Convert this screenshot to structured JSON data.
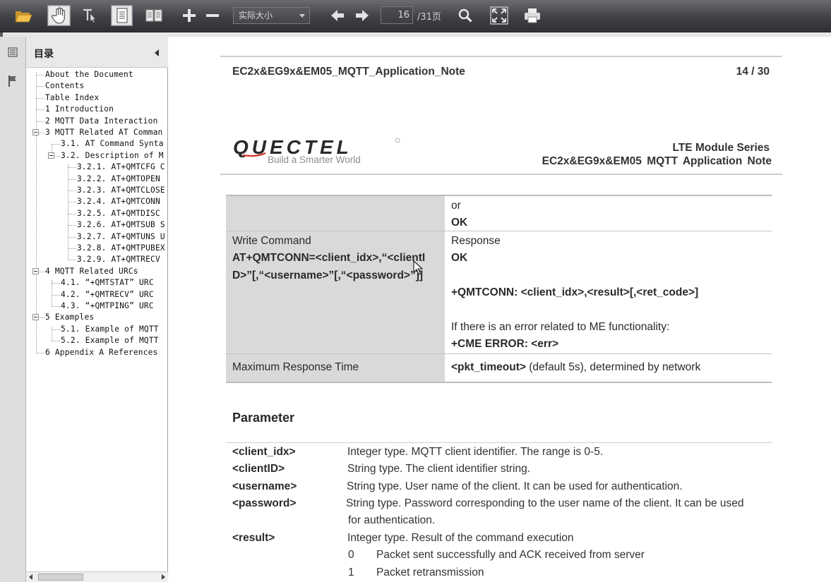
{
  "toolbar": {
    "zoom_value": "实际大小",
    "page_current": "16",
    "page_total": "/31页"
  },
  "sidebar": {
    "title": "目录",
    "items": [
      {
        "label": "About the Document"
      },
      {
        "label": "Contents"
      },
      {
        "label": "Table Index"
      },
      {
        "label": "1 Introduction"
      },
      {
        "label": "2 MQTT Data Interaction"
      },
      {
        "label": "3 MQTT Related AT Comman"
      },
      {
        "label": "3.1. AT Command Synta"
      },
      {
        "label": "3.2. Description of M"
      },
      {
        "label": "3.2.1. AT+QMTCFG C"
      },
      {
        "label": "3.2.2. AT+QMTOPEN"
      },
      {
        "label": "3.2.3. AT+QMTCLOSE"
      },
      {
        "label": "3.2.4. AT+QMTCONN"
      },
      {
        "label": "3.2.5. AT+QMTDISC"
      },
      {
        "label": "3.2.6. AT+QMTSUB S"
      },
      {
        "label": "3.2.7. AT+QMTUNS U"
      },
      {
        "label": "3.2.8. AT+QMTPUBEX"
      },
      {
        "label": "3.2.9. AT+QMTRECV"
      },
      {
        "label": "4 MQTT Related URCs"
      },
      {
        "label": "4.1. “+QMTSTAT” URC"
      },
      {
        "label": "4.2. “+QMTRECV” URC"
      },
      {
        "label": "4.3. “+QMTPING” URC"
      },
      {
        "label": "5 Examples"
      },
      {
        "label": "5.1. Example of MQTT"
      },
      {
        "label": "5.2. Example of MQTT"
      },
      {
        "label": "6 Appendix A References"
      }
    ]
  },
  "document": {
    "header_left": "EC2x&EG9x&EM05_MQTT_Application_Note",
    "header_right": "14 / 30",
    "logo_text": "QUECTEL",
    "logo_tagline": "Build a Smarter World",
    "series_line1": "LTE Module Series",
    "series_line2": "EC2x&EG9x&EM05 MQTT Application Note",
    "table": {
      "row1_or": "or",
      "row1_ok": "OK",
      "write_label": "Write Command",
      "write_cmd_line1": "AT+QMTCONN=<client_idx>,“<clientI",
      "write_cmd_line2": "D>”[,“<username>”[,“<password>”]]",
      "response_label": "Response",
      "response_ok": "OK",
      "response_urc": "+QMTCONN: <client_idx>,<result>[,<ret_code>]",
      "error_note": "If there is an error related to ME functionality:",
      "error_code": "+CME ERROR: <err>",
      "max_time_label": "Maximum Response Time",
      "max_time_param": "<pkt_timeout>",
      "max_time_rest": " (default 5s), determined by network"
    },
    "parameter_heading": "Parameter",
    "parameters": [
      {
        "name": "<client_idx>",
        "desc": "Integer type. MQTT client identifier. The range is 0-5."
      },
      {
        "name": "<clientID>",
        "desc": "String type. The client identifier string."
      },
      {
        "name": "<username>",
        "desc": "String type. User name of the client. It can be used for authentication."
      },
      {
        "name": "<password>",
        "desc": "String type. Password corresponding to the user name of the client. It can be used",
        "desc2": "for authentication."
      },
      {
        "name": "<result>",
        "desc": "Integer type. Result of the command execution"
      }
    ],
    "result_values": [
      {
        "code": "0",
        "text": "Packet sent successfully and ACK received from server"
      },
      {
        "code": "1",
        "text": "Packet retransmission"
      }
    ]
  }
}
